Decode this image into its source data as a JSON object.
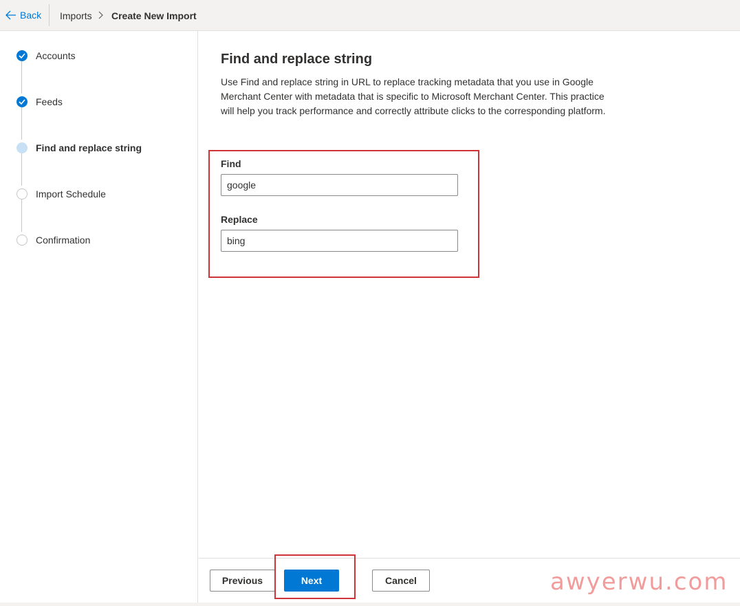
{
  "topbar": {
    "back_label": "Back",
    "breadcrumb": {
      "parent": "Imports",
      "separator": ">",
      "current": "Create New Import"
    }
  },
  "steps": [
    {
      "label": "Accounts",
      "state": "done"
    },
    {
      "label": "Feeds",
      "state": "done"
    },
    {
      "label": "Find and replace string",
      "state": "current"
    },
    {
      "label": "Import Schedule",
      "state": "pending"
    },
    {
      "label": "Confirmation",
      "state": "pending"
    }
  ],
  "main": {
    "title": "Find and replace string",
    "description": "Use Find and replace string in URL to replace tracking metadata that you use in Google Merchant Center with metadata that is specific to Microsoft Merchant Center. This practice will help you track performance and correctly attribute clicks to the corresponding platform.",
    "find": {
      "label": "Find",
      "value": "google"
    },
    "replace": {
      "label": "Replace",
      "value": "bing"
    }
  },
  "footer": {
    "previous_label": "Previous",
    "next_label": "Next",
    "cancel_label": "Cancel"
  },
  "watermark": "awyerwu.com",
  "colors": {
    "accent": "#0078d4",
    "highlight": "#d13438",
    "current_step": "#c7e0f4"
  }
}
